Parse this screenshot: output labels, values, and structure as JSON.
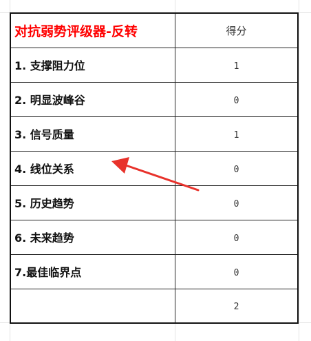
{
  "table": {
    "title": "对抗弱势评级器-反转",
    "score_header": "得分",
    "rows": [
      {
        "label": "1. 支撑阻力位",
        "score": "1"
      },
      {
        "label": "2. 明显波峰谷",
        "score": "0"
      },
      {
        "label": "3. 信号质量",
        "score": "1"
      },
      {
        "label": "4. 线位关系",
        "score": "0"
      },
      {
        "label": "5. 历史趋势",
        "score": "0"
      },
      {
        "label": "6. 未来趋势",
        "score": "0"
      },
      {
        "label": "7.最佳临界点",
        "score": "0"
      }
    ],
    "total_label": "",
    "total_score": "2"
  },
  "annotation": {
    "arrow_color": "#e8322b",
    "arrow_target": "4. 线位关系"
  },
  "colors": {
    "title": "#ff0000",
    "gridline": "#e3e3e3",
    "border": "#222222"
  }
}
